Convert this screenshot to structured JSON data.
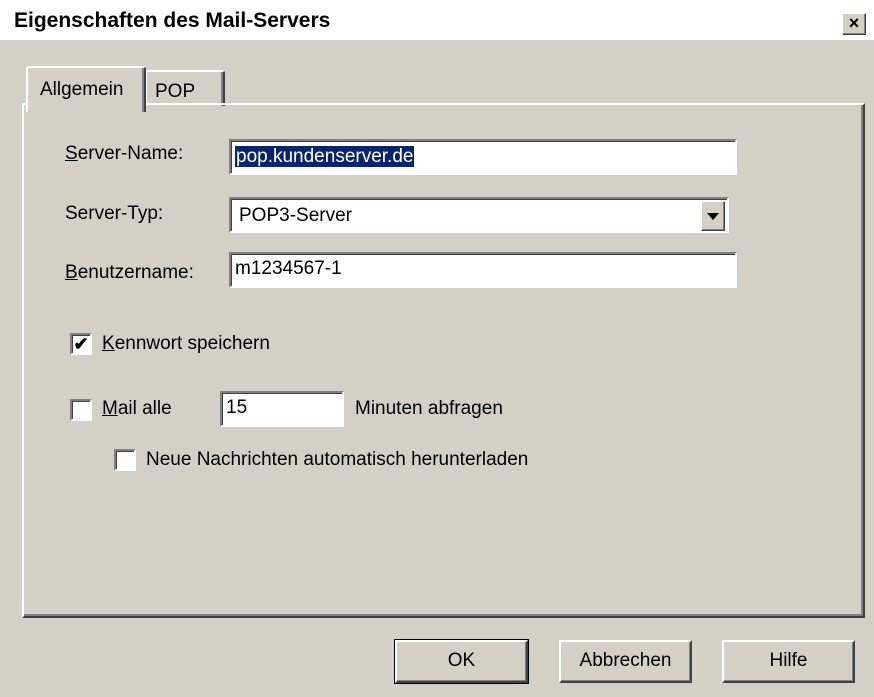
{
  "window": {
    "title": "Eigenschaften des Mail-Servers",
    "close_label": "×"
  },
  "tabs": [
    {
      "label": "Allgemein",
      "active": true
    },
    {
      "label": "POP",
      "active": false
    }
  ],
  "form": {
    "server_name_label": "Server-Name:",
    "server_name_value": "pop.kundenserver.de",
    "server_type_label": "Server-Typ:",
    "server_type_value": "POP3-Server",
    "username_label": "Benutzername:",
    "username_value": "m1234567-1",
    "save_password_label": "Kennwort speichern",
    "save_password_checked": "✔",
    "check_mail_label": "Mail alle",
    "check_mail_interval": "15",
    "check_mail_suffix": "Minuten abfragen",
    "auto_download_label": "Neue Nachrichten automatisch herunterladen"
  },
  "buttons": {
    "ok": "OK",
    "cancel": "Abbrechen",
    "help": "Hilfe"
  },
  "colors": {
    "face": "#d4d0c8",
    "selection": "#0a246a"
  }
}
